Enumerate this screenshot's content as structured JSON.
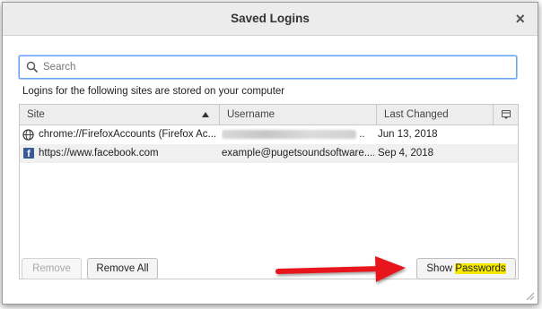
{
  "window": {
    "title": "Saved Logins",
    "close_label": "×"
  },
  "search": {
    "placeholder": "Search"
  },
  "description": "Logins for the following sites are stored on your computer",
  "table": {
    "columns": [
      "Site",
      "Username",
      "Last Changed"
    ],
    "rows": [
      {
        "site": "chrome://FirefoxAccounts (Firefox Ac...",
        "username": "..",
        "last_changed": "Jun 13, 2018",
        "icon": "globe-icon",
        "username_obscured": true
      },
      {
        "site": "https://www.facebook.com",
        "username": "example@pugetsoundsoftware....",
        "last_changed": "Sep 4, 2018",
        "icon": "facebook-icon",
        "username_obscured": false
      }
    ]
  },
  "buttons": {
    "remove": "Remove",
    "remove_all": "Remove All",
    "show_passwords_prefix": "Show ",
    "show_passwords_highlight": "Passwords"
  },
  "colors": {
    "accent": "#6aa5f5",
    "highlight": "#f5e900",
    "arrow": "#e8191e",
    "facebook": "#3b5998"
  }
}
